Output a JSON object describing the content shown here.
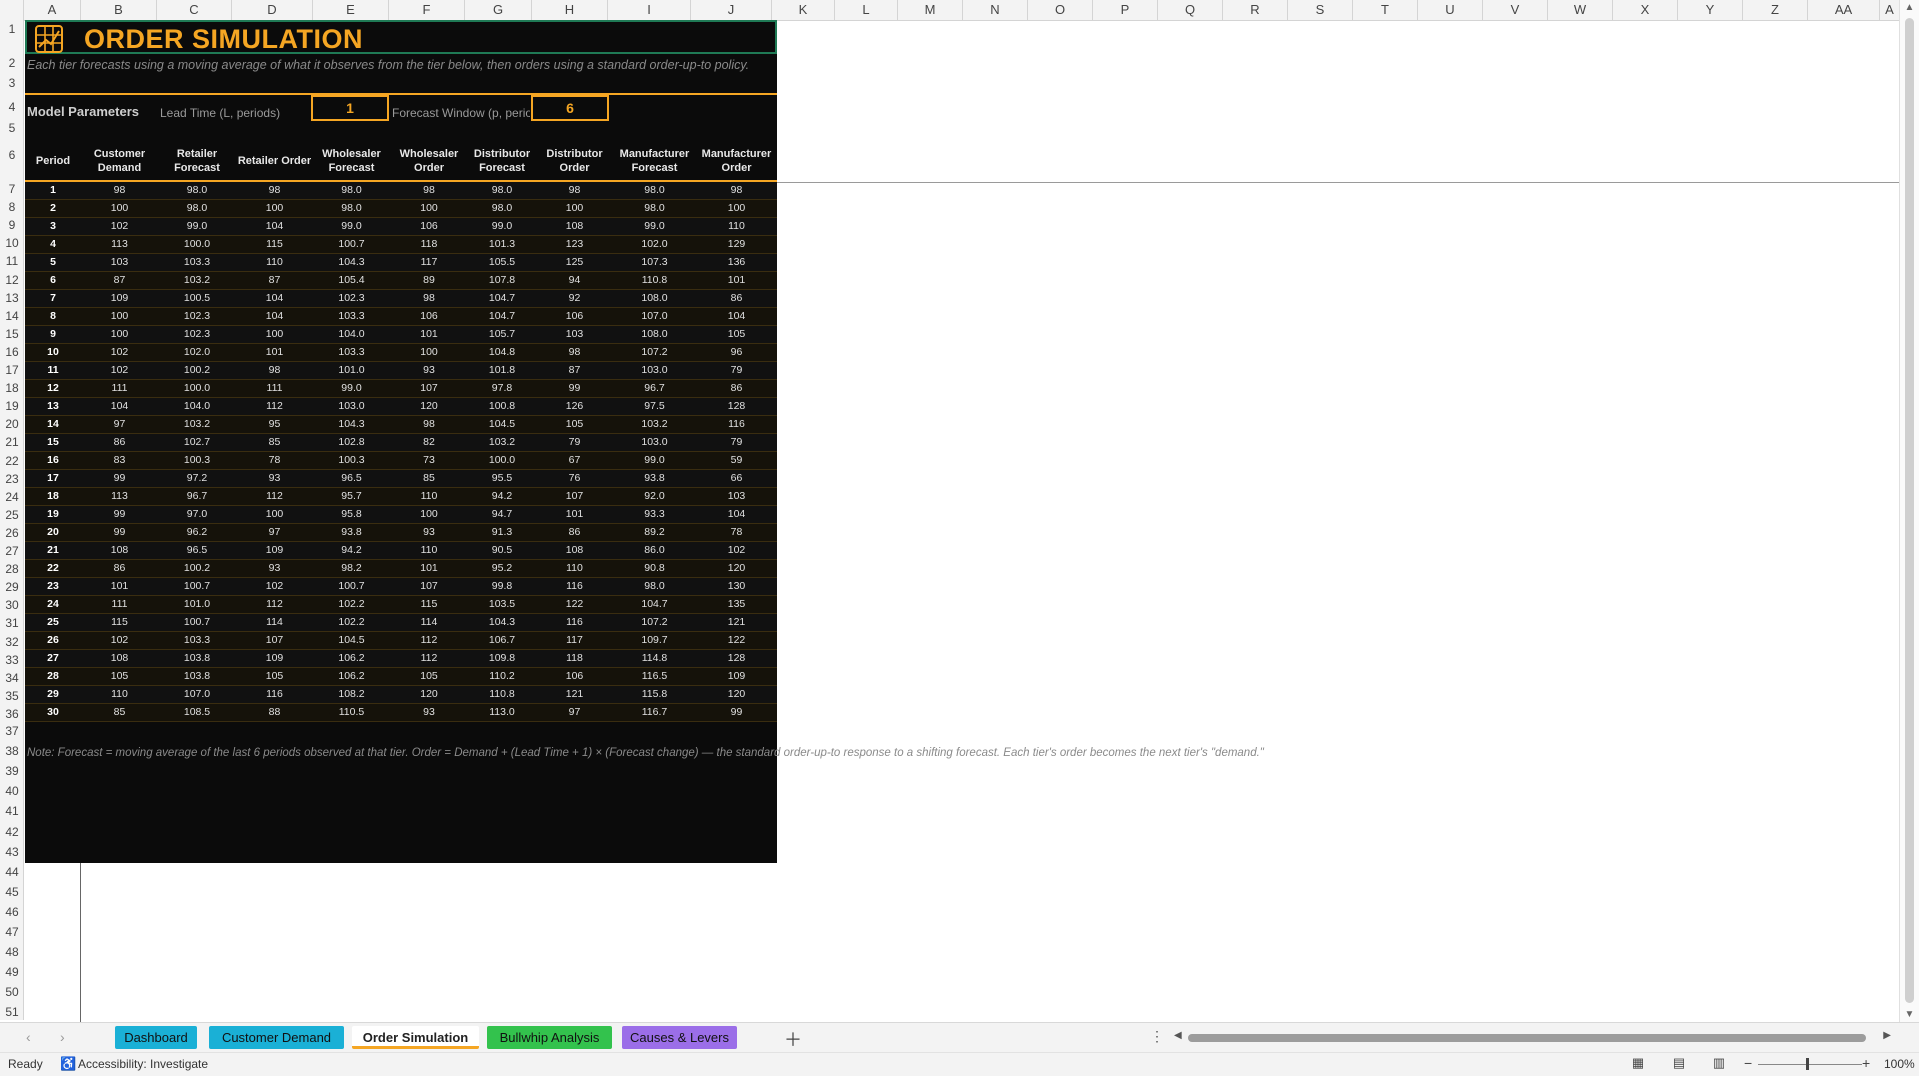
{
  "columns": [
    "A",
    "B",
    "C",
    "D",
    "E",
    "F",
    "G",
    "H",
    "I",
    "J",
    "K",
    "L",
    "M",
    "N",
    "O",
    "P",
    "Q",
    "R",
    "S",
    "T",
    "U",
    "V",
    "W",
    "X",
    "Y",
    "Z",
    "AA",
    "A"
  ],
  "rows": [
    "1",
    "2",
    "3",
    "4",
    "5",
    "6",
    "7",
    "8",
    "9",
    "10",
    "11",
    "12",
    "13",
    "14",
    "15",
    "16",
    "17",
    "18",
    "19",
    "20",
    "21",
    "22",
    "23",
    "24",
    "25",
    "26",
    "27",
    "28",
    "29",
    "30",
    "31",
    "32",
    "33",
    "34",
    "35",
    "36",
    "37",
    "38",
    "39",
    "40",
    "41",
    "42",
    "43",
    "44",
    "45",
    "46",
    "47",
    "48",
    "49",
    "50",
    "51"
  ],
  "sheet": {
    "title": "ORDER SIMULATION",
    "title_icon": "grid-chart-icon",
    "subtitle": "Each tier forecasts using a moving average of what it observes from the tier below, then orders using a standard order-up-to policy.",
    "params": {
      "section_label": "Model Parameters",
      "lead_time_label": "Lead Time (L, periods)",
      "lead_time_value": "1",
      "forecast_window_label": "Forecast Window (p, periods)",
      "forecast_window_value": "6"
    },
    "table": {
      "headers": [
        "Period",
        "Customer Demand",
        "Retailer Forecast",
        "Retailer Order",
        "Wholesaler Forecast",
        "Wholesaler Order",
        "Distributor Forecast",
        "Distributor Order",
        "Manufacturer Forecast",
        "Manufacturer Order"
      ],
      "rows": [
        [
          "1",
          "98",
          "98.0",
          "98",
          "98.0",
          "98",
          "98.0",
          "98",
          "98.0",
          "98"
        ],
        [
          "2",
          "100",
          "98.0",
          "100",
          "98.0",
          "100",
          "98.0",
          "100",
          "98.0",
          "100"
        ],
        [
          "3",
          "102",
          "99.0",
          "104",
          "99.0",
          "106",
          "99.0",
          "108",
          "99.0",
          "110"
        ],
        [
          "4",
          "113",
          "100.0",
          "115",
          "100.7",
          "118",
          "101.3",
          "123",
          "102.0",
          "129"
        ],
        [
          "5",
          "103",
          "103.3",
          "110",
          "104.3",
          "117",
          "105.5",
          "125",
          "107.3",
          "136"
        ],
        [
          "6",
          "87",
          "103.2",
          "87",
          "105.4",
          "89",
          "107.8",
          "94",
          "110.8",
          "101"
        ],
        [
          "7",
          "109",
          "100.5",
          "104",
          "102.3",
          "98",
          "104.7",
          "92",
          "108.0",
          "86"
        ],
        [
          "8",
          "100",
          "102.3",
          "104",
          "103.3",
          "106",
          "104.7",
          "106",
          "107.0",
          "104"
        ],
        [
          "9",
          "100",
          "102.3",
          "100",
          "104.0",
          "101",
          "105.7",
          "103",
          "108.0",
          "105"
        ],
        [
          "10",
          "102",
          "102.0",
          "101",
          "103.3",
          "100",
          "104.8",
          "98",
          "107.2",
          "96"
        ],
        [
          "11",
          "102",
          "100.2",
          "98",
          "101.0",
          "93",
          "101.8",
          "87",
          "103.0",
          "79"
        ],
        [
          "12",
          "111",
          "100.0",
          "111",
          "99.0",
          "107",
          "97.8",
          "99",
          "96.7",
          "86"
        ],
        [
          "13",
          "104",
          "104.0",
          "112",
          "103.0",
          "120",
          "100.8",
          "126",
          "97.5",
          "128"
        ],
        [
          "14",
          "97",
          "103.2",
          "95",
          "104.3",
          "98",
          "104.5",
          "105",
          "103.2",
          "116"
        ],
        [
          "15",
          "86",
          "102.7",
          "85",
          "102.8",
          "82",
          "103.2",
          "79",
          "103.0",
          "79"
        ],
        [
          "16",
          "83",
          "100.3",
          "78",
          "100.3",
          "73",
          "100.0",
          "67",
          "99.0",
          "59"
        ],
        [
          "17",
          "99",
          "97.2",
          "93",
          "96.5",
          "85",
          "95.5",
          "76",
          "93.8",
          "66"
        ],
        [
          "18",
          "113",
          "96.7",
          "112",
          "95.7",
          "110",
          "94.2",
          "107",
          "92.0",
          "103"
        ],
        [
          "19",
          "99",
          "97.0",
          "100",
          "95.8",
          "100",
          "94.7",
          "101",
          "93.3",
          "104"
        ],
        [
          "20",
          "99",
          "96.2",
          "97",
          "93.8",
          "93",
          "91.3",
          "86",
          "89.2",
          "78"
        ],
        [
          "21",
          "108",
          "96.5",
          "109",
          "94.2",
          "110",
          "90.5",
          "108",
          "86.0",
          "102"
        ],
        [
          "22",
          "86",
          "100.2",
          "93",
          "98.2",
          "101",
          "95.2",
          "110",
          "90.8",
          "120"
        ],
        [
          "23",
          "101",
          "100.7",
          "102",
          "100.7",
          "107",
          "99.8",
          "116",
          "98.0",
          "130"
        ],
        [
          "24",
          "111",
          "101.0",
          "112",
          "102.2",
          "115",
          "103.5",
          "122",
          "104.7",
          "135"
        ],
        [
          "25",
          "115",
          "100.7",
          "114",
          "102.2",
          "114",
          "104.3",
          "116",
          "107.2",
          "121"
        ],
        [
          "26",
          "102",
          "103.3",
          "107",
          "104.5",
          "112",
          "106.7",
          "117",
          "109.7",
          "122"
        ],
        [
          "27",
          "108",
          "103.8",
          "109",
          "106.2",
          "112",
          "109.8",
          "118",
          "114.8",
          "128"
        ],
        [
          "28",
          "105",
          "103.8",
          "105",
          "106.2",
          "105",
          "110.2",
          "106",
          "116.5",
          "109"
        ],
        [
          "29",
          "110",
          "107.0",
          "116",
          "108.2",
          "120",
          "110.8",
          "121",
          "115.8",
          "120"
        ],
        [
          "30",
          "85",
          "108.5",
          "88",
          "110.5",
          "93",
          "113.0",
          "97",
          "116.7",
          "99"
        ]
      ]
    },
    "note": "Note: Forecast = moving average of the last 6 periods observed at that tier. Order = Demand + (Lead Time + 1) × (Forecast change) — the standard order-up-to response to a shifting forecast. Each tier's order becomes the next tier's \"demand.\""
  },
  "tabs": [
    {
      "label": "Dashboard",
      "color": "#1ab0d6",
      "active": false
    },
    {
      "label": "Customer Demand",
      "color": "#1ab0d6",
      "active": false
    },
    {
      "label": "Order Simulation",
      "color": "#f5a623",
      "active": true
    },
    {
      "label": "Bullwhip Analysis",
      "color": "#33c24d",
      "active": false
    },
    {
      "label": "Causes & Levers",
      "color": "#9b6ee8",
      "active": false
    }
  ],
  "status": {
    "ready": "Ready",
    "accessibility": "Accessibility: Investigate",
    "zoom": "100%"
  },
  "colors": {
    "accent": "#f5a623",
    "sheet_bg": "#0b0b0b",
    "selection": "#1f7a55"
  }
}
